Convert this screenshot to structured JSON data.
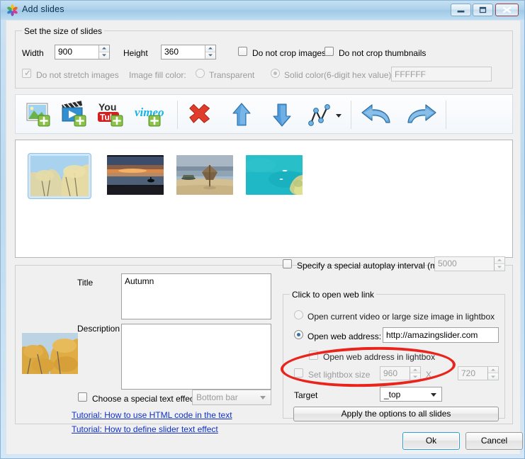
{
  "window": {
    "title": "Add slides",
    "icon": "app-logo-pinwheel-icon",
    "controls": {
      "minimize": "minimize-icon",
      "maximize": "maximize-icon",
      "close": "close-icon"
    }
  },
  "size_group": {
    "legend": "Set the size of slides",
    "width_label": "Width",
    "width_value": "900",
    "height_label": "Height",
    "height_value": "360",
    "do_not_crop_images": "Do not crop images",
    "do_not_crop_thumbnails": "Do not crop thumbnails",
    "do_not_stretch_images": "Do not stretch images",
    "image_fill_color_label": "Image fill color:",
    "transparent": "Transparent",
    "solid_color": "Solid color(6-digit hex value):",
    "solid_color_value": "FFFFFF"
  },
  "toolbar": {
    "items": [
      {
        "name": "add-image-button",
        "icon": "add-image-icon"
      },
      {
        "name": "add-video-button",
        "icon": "add-video-icon"
      },
      {
        "name": "add-youtube-button",
        "icon": "add-youtube-icon"
      },
      {
        "name": "add-vimeo-button",
        "icon": "add-vimeo-icon"
      },
      {
        "name": "delete-slide-button",
        "icon": "red-x-delete-icon"
      },
      {
        "name": "move-up-button",
        "icon": "arrow-up-icon"
      },
      {
        "name": "move-down-button",
        "icon": "arrow-down-icon"
      },
      {
        "name": "effects-button",
        "icon": "line-chart-icon"
      },
      {
        "name": "effects-dropdown-button",
        "icon": "chevron-down-icon"
      },
      {
        "name": "undo-button",
        "icon": "undo-arrow-icon"
      },
      {
        "name": "redo-button",
        "icon": "redo-arrow-icon"
      }
    ]
  },
  "slides": [
    {
      "name": "slide-thumbnail-autumn",
      "alt": "Autumn trees against blue sky",
      "selected": true
    },
    {
      "name": "slide-thumbnail-sunset",
      "alt": "Sunset over the sea",
      "selected": false
    },
    {
      "name": "slide-thumbnail-beach-umbrella",
      "alt": "Beach with straw umbrella",
      "selected": false
    },
    {
      "name": "slide-thumbnail-turquoise-sea",
      "alt": "Turquoise sea from above",
      "selected": false
    }
  ],
  "slide_editor": {
    "title_label": "Title",
    "title_value": "Autumn",
    "description_label": "Description",
    "description_value": "",
    "preview_alt": "Autumn trees thumbnail preview",
    "special_text_effect": "Choose a special text effect",
    "text_effect_selected": "Bottom bar",
    "tutorial_html": "Tutorial: How to use HTML code in the text",
    "tutorial_effect": "Tutorial: How to define slider text effect"
  },
  "options": {
    "autoplay_label": "Specify a special autoplay interval (ms):",
    "autoplay_value": "5000",
    "weblink_legend": "Click to open web link",
    "open_lightbox": "Open current video or large size image in lightbox",
    "open_web_address": "Open web address:",
    "web_address_value": "http://amazingslider.com",
    "open_in_lightbox": "Open web address in lightbox",
    "set_lightbox_size": "Set lightbox size",
    "lightbox_width": "960",
    "lightbox_x": "X",
    "lightbox_height": "720",
    "target_label": "Target",
    "target_value": "_top",
    "apply_all": "Apply the options to all slides"
  },
  "footer": {
    "ok": "Ok",
    "cancel": "Cancel"
  },
  "annotation": {
    "name": "red-highlight-ellipse",
    "color": "#e8241c"
  }
}
